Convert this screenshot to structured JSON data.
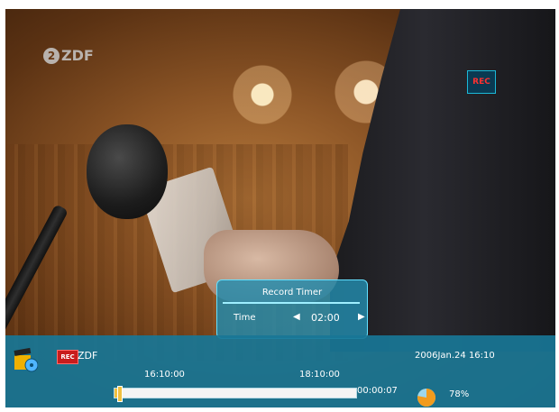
{
  "overlay": {
    "logo_text": "ZDF",
    "rec_label": "REC"
  },
  "record_timer": {
    "title": "Record Timer",
    "field_label": "Time",
    "value": "02:00",
    "left_arrow": "◀",
    "right_arrow": "▶"
  },
  "info_bar": {
    "rec_badge": "REC",
    "channel": "ZDF",
    "datetime": "2006Jan.24  16:10",
    "start_time": "16:10:00",
    "end_time": "18:10:00",
    "elapsed": "00:00:07",
    "progress_fraction": 0.01,
    "signal_percent": "78%",
    "signal_level": 0.78
  },
  "colors": {
    "bar_background": "#1876a0",
    "accent": "#63e0ff",
    "rec_red": "#c81c1c",
    "progress_fill": "#f0c040"
  }
}
